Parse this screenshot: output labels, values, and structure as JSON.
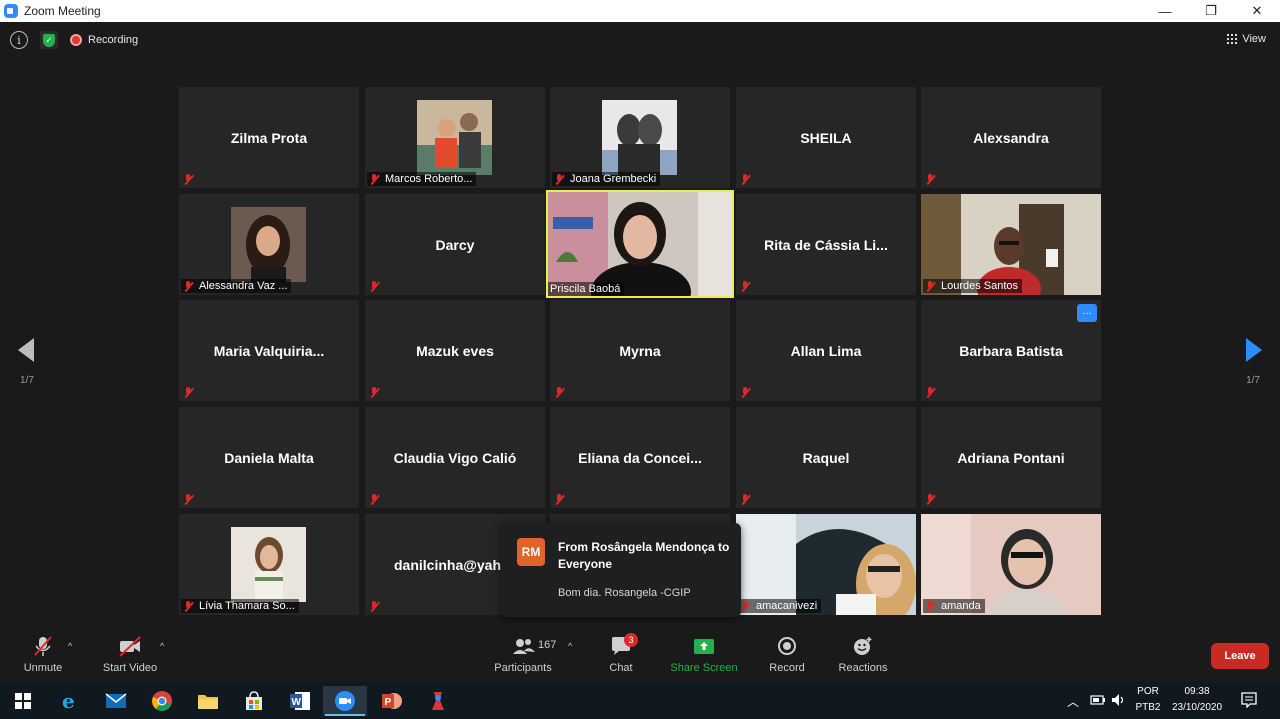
{
  "window": {
    "title": "Zoom Meeting",
    "minimize": "—",
    "restore": "❐",
    "close": "✕"
  },
  "topbar": {
    "info_glyph": "i",
    "shield_glyph": "✓",
    "recording_label": "Recording",
    "view_label": "View"
  },
  "gallery": {
    "page_indicator_left": "1/7",
    "page_indicator_right": "1/7",
    "tiles": [
      {
        "name": "Zilma Prota",
        "label": "",
        "video": false
      },
      {
        "name": "",
        "label": "Marcos Roberto...",
        "video": "avatar"
      },
      {
        "name": "",
        "label": "Joana Grembecki",
        "video": "avatar"
      },
      {
        "name": "SHEILA",
        "label": "",
        "video": false
      },
      {
        "name": "Alexsandra",
        "label": "",
        "video": false
      },
      {
        "name": "",
        "label": "Alessandra Vaz ...",
        "video": "avatar"
      },
      {
        "name": "Darcy",
        "label": "",
        "video": false
      },
      {
        "name": "",
        "label": "Priscila Baobá",
        "video": "live"
      },
      {
        "name": "Rita de Cássia Li...",
        "label": "",
        "video": false
      },
      {
        "name": "",
        "label": "Lourdes Santos",
        "video": "live"
      },
      {
        "name": "Maria  Valquiria...",
        "label": "",
        "video": false
      },
      {
        "name": "Mazuk eves",
        "label": "",
        "video": false
      },
      {
        "name": "Myrna",
        "label": "",
        "video": false
      },
      {
        "name": "Allan Lima",
        "label": "",
        "video": false
      },
      {
        "name": "Barbara Batista",
        "label": "",
        "video": false
      },
      {
        "name": "Daniela Malta",
        "label": "",
        "video": false
      },
      {
        "name": "Claudia Vigo Calió",
        "label": "",
        "video": false
      },
      {
        "name": "Eliana  da  Concei...",
        "label": "",
        "video": false
      },
      {
        "name": "Raquel",
        "label": "",
        "video": false
      },
      {
        "name": "Adriana Pontani",
        "label": "",
        "video": false
      },
      {
        "name": "",
        "label": "Lívia Thamara So...",
        "video": "avatar"
      },
      {
        "name": "danilcinha@yah",
        "label": "",
        "video": false
      },
      {
        "name": "",
        "label": "",
        "video": false
      },
      {
        "name": "",
        "label": "amacanivezi",
        "video": "live"
      },
      {
        "name": "",
        "label": "amanda",
        "video": "live"
      }
    ],
    "more_button": "···"
  },
  "chat_popup": {
    "initials": "RM",
    "from": "From Rosângela Mendonça to Everyone",
    "message": "Bom dia. Rosangela -CGIP"
  },
  "toolbar": {
    "unmute": "Unmute",
    "start_video": "Start Video",
    "participants": "Participants",
    "participants_count": "167",
    "chat": "Chat",
    "chat_badge": "3",
    "share_screen": "Share Screen",
    "record": "Record",
    "reactions": "Reactions",
    "leave": "Leave",
    "caret": "^"
  },
  "taskbar": {
    "lang_top": "POR",
    "lang_bottom": "PTB2",
    "time": "09:38",
    "date": "23/10/2020"
  },
  "colors": {
    "zoom_blue": "#2d8cff",
    "active_speaker": "#e6ee51",
    "muted_red": "#e02828",
    "share_green": "#22b14c",
    "leave_red": "#c92a23"
  }
}
